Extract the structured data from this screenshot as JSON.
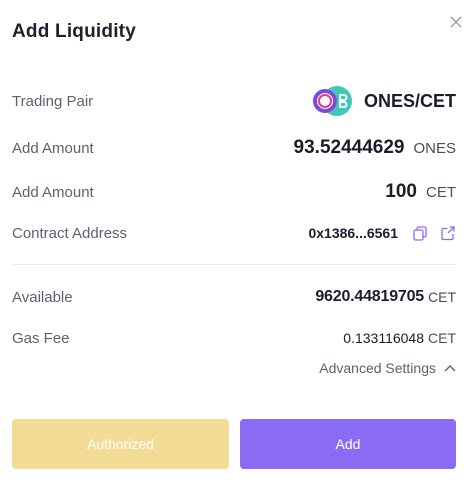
{
  "dialog": {
    "title": "Add Liquidity"
  },
  "rows": {
    "trading_pair": {
      "label": "Trading Pair",
      "value": "ONES/CET",
      "logo_icon": "ob-token-logo"
    },
    "amount_ones": {
      "label": "Add Amount",
      "value": "93.52444629",
      "unit": "ONES"
    },
    "amount_cet": {
      "label": "Add Amount",
      "value": "100",
      "unit": "CET"
    },
    "contract": {
      "label": "Contract Address",
      "value": "0x1386...6561",
      "copy_icon": "copy-icon",
      "open_icon": "external-link-icon"
    },
    "available": {
      "label": "Available",
      "value": "9620.44819705",
      "unit": "CET"
    },
    "gas_fee": {
      "label": "Gas Fee",
      "value": "0.133116048",
      "unit": "CET"
    }
  },
  "advanced": {
    "label": "Advanced Settings",
    "icon": "chevron-up-icon"
  },
  "buttons": {
    "authorized_label": "Authorized",
    "add_label": "Add"
  },
  "colors": {
    "authorized_bg": "#f3dc96",
    "add_bg": "#8a6cf4",
    "logo_purple": "#7b4bd9",
    "logo_teal": "#3fc9b5"
  }
}
